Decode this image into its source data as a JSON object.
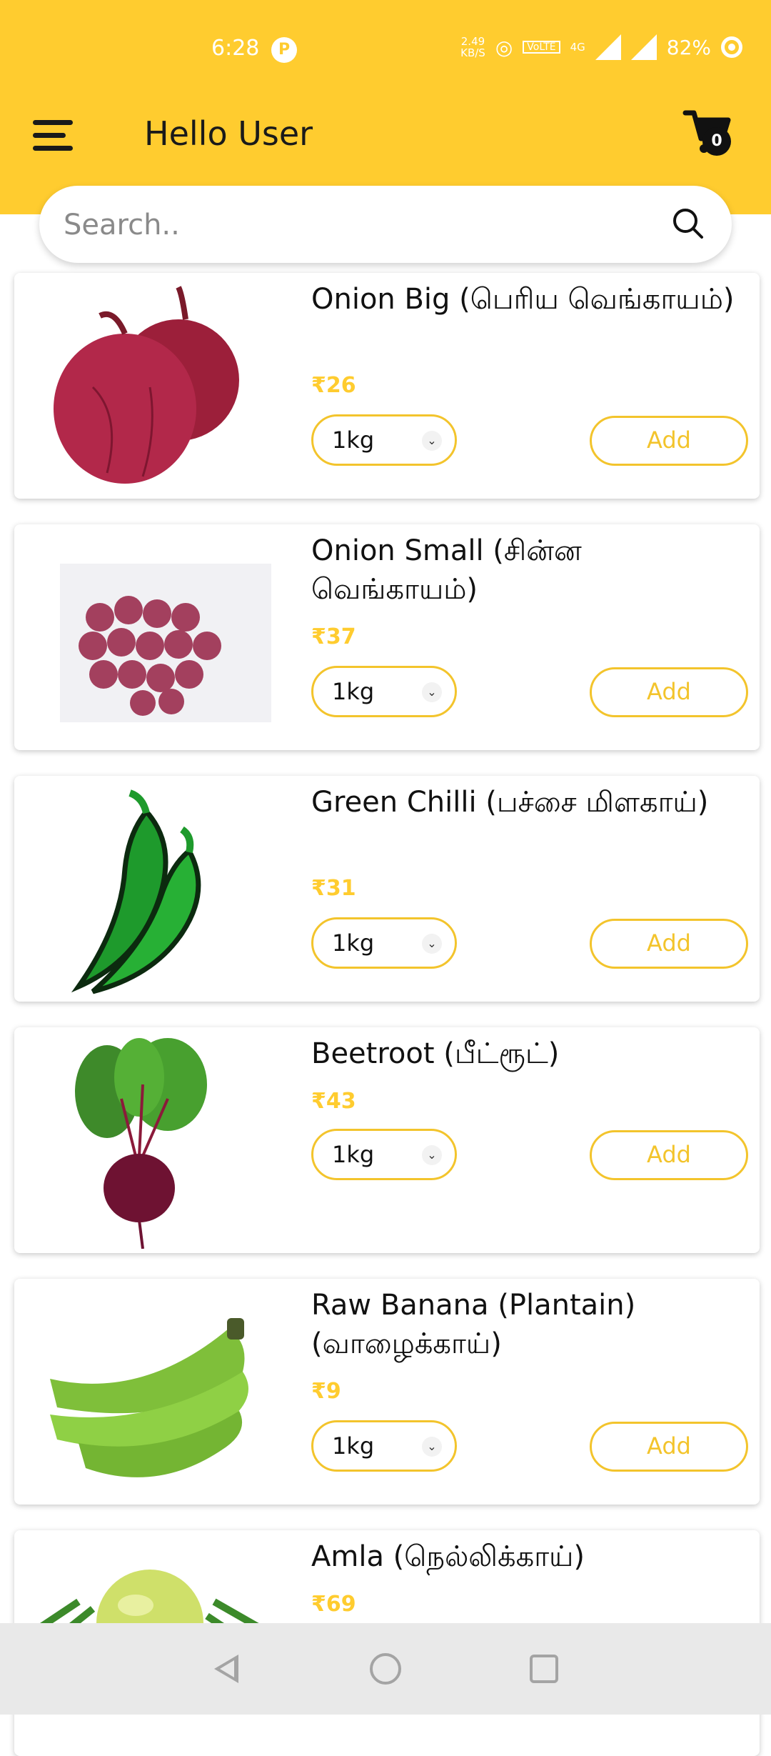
{
  "status": {
    "time": "6:28",
    "speed_value": "2.49",
    "speed_unit": "KB/S",
    "volte": "VoLTE",
    "network": "4G",
    "battery": "82%"
  },
  "header": {
    "title": "Hello User",
    "cart_count": "0"
  },
  "search": {
    "placeholder": "Search.."
  },
  "colors": {
    "accent": "#FFCC2F",
    "text": "#111111",
    "navbar": "#e9e9e9"
  },
  "products": [
    {
      "name": "Onion Big (பெரிய வெங்காயம்)",
      "price": "₹26",
      "qty": "1kg",
      "add": "Add"
    },
    {
      "name": "Onion Small (சின்ன வெங்காயம்)",
      "price": "₹37",
      "qty": "1kg",
      "add": "Add"
    },
    {
      "name": " Green Chilli (பச்சை மிளகாய்)",
      "price": "₹31",
      "qty": "1kg",
      "add": "Add"
    },
    {
      "name": "Beetroot (பீட்ரூட்)",
      "price": "₹43",
      "qty": "1kg",
      "add": "Add"
    },
    {
      "name": "Raw Banana (Plantain) (வாழைக்காய்)",
      "price": "₹9",
      "qty": "1kg",
      "add": "Add"
    },
    {
      "name": " Amla (நெல்லிக்காய்)",
      "price": "₹69"
    }
  ],
  "icons": {
    "menu": "hamburger-menu-icon",
    "cart": "shopping-cart-icon",
    "search": "search-icon",
    "qty_dropdown": "chevron-down-icon"
  }
}
